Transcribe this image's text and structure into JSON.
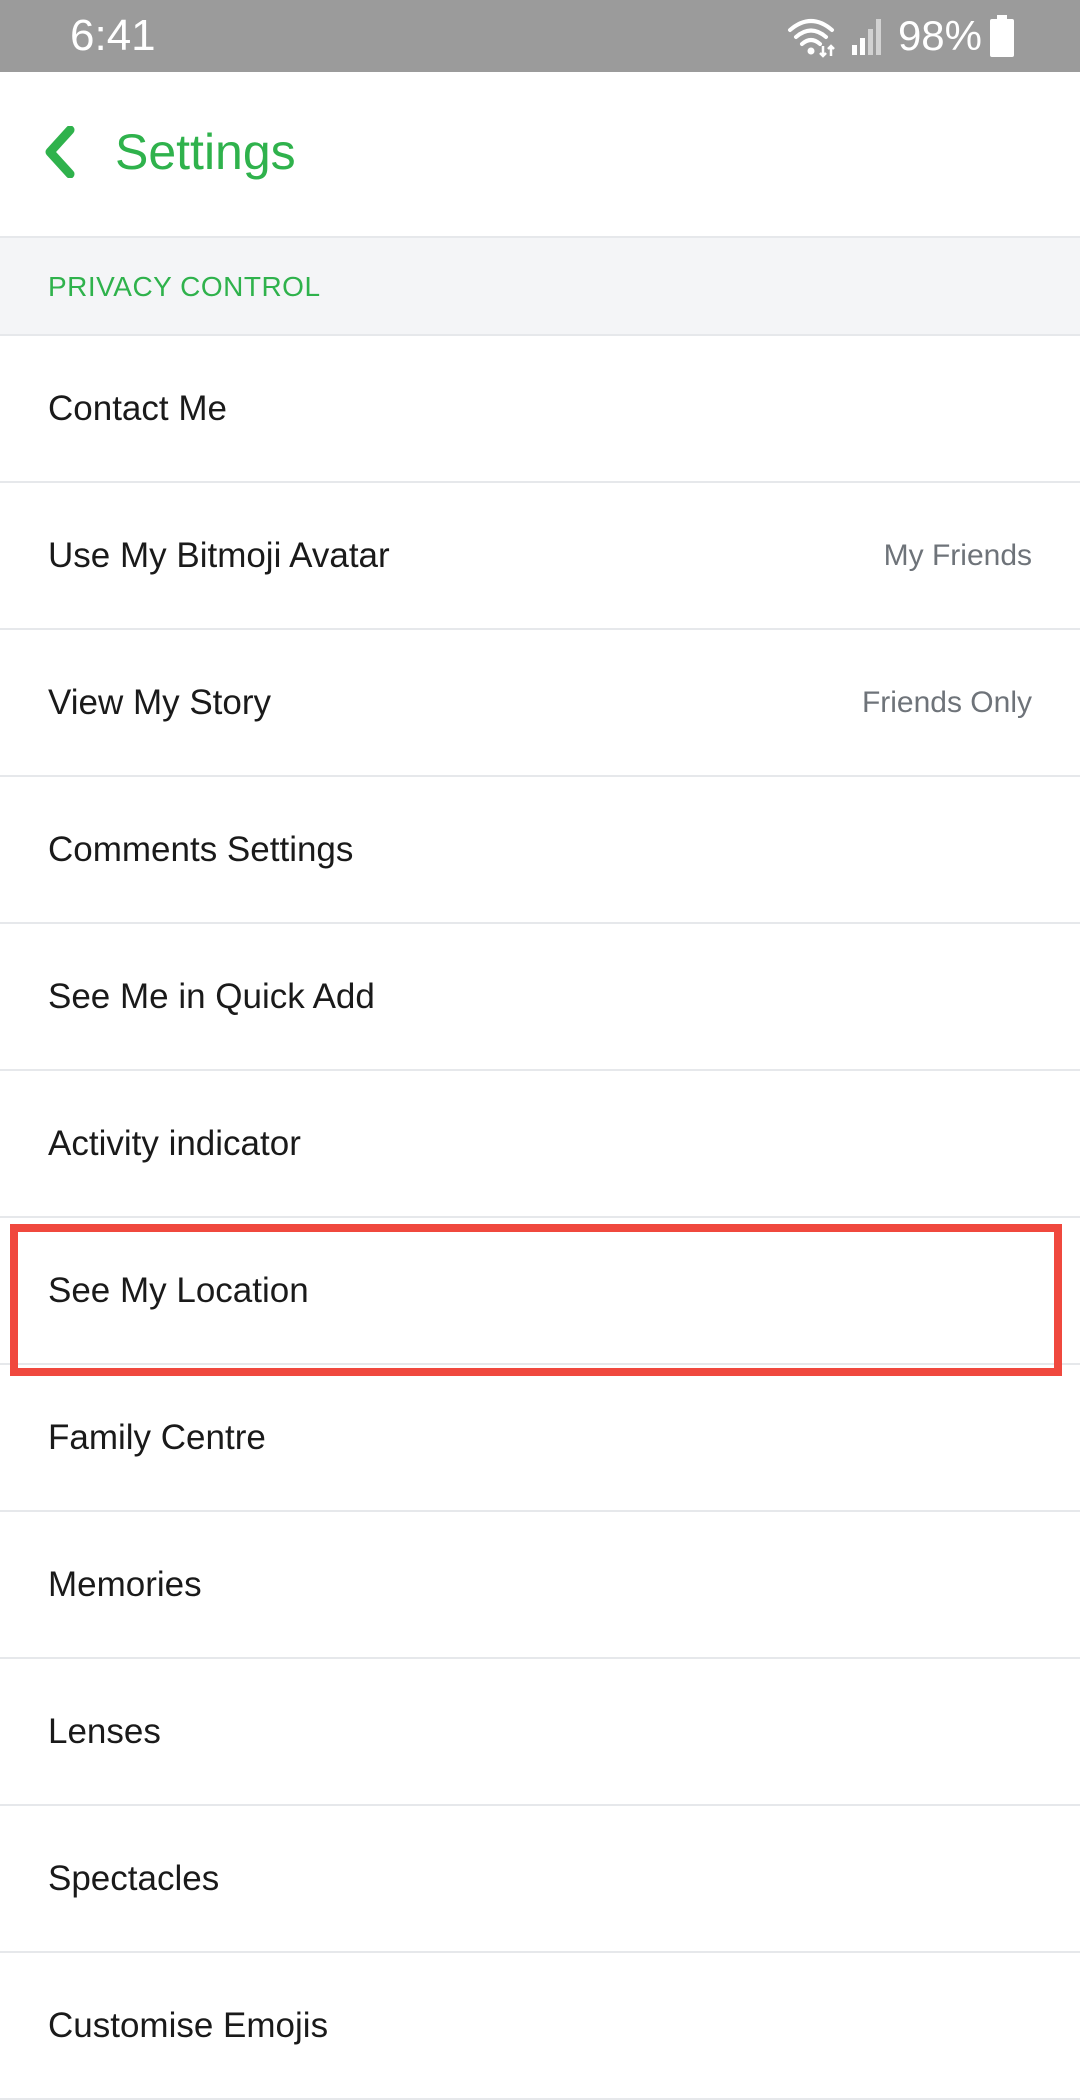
{
  "status_bar": {
    "time": "6:41",
    "battery": "98%",
    "icons": [
      "wifi-icon",
      "signal-icon",
      "battery-icon"
    ]
  },
  "header": {
    "back_icon": "chevron-left-icon",
    "title": "Settings",
    "accent_color": "#2fb24c"
  },
  "section": {
    "title": "PRIVACY CONTROL"
  },
  "items": [
    {
      "label": "Contact Me",
      "value": ""
    },
    {
      "label": "Use My Bitmoji Avatar",
      "value": "My Friends"
    },
    {
      "label": "View My Story",
      "value": "Friends Only"
    },
    {
      "label": "Comments Settings",
      "value": ""
    },
    {
      "label": "See Me in Quick Add",
      "value": ""
    },
    {
      "label": "Activity indicator",
      "value": ""
    },
    {
      "label": "See My Location",
      "value": "",
      "highlighted": true
    },
    {
      "label": "Family Centre",
      "value": ""
    },
    {
      "label": "Memories",
      "value": ""
    },
    {
      "label": "Lenses",
      "value": ""
    },
    {
      "label": "Spectacles",
      "value": ""
    },
    {
      "label": "Customise Emojis",
      "value": ""
    }
  ],
  "highlight_color": "#f0483e"
}
